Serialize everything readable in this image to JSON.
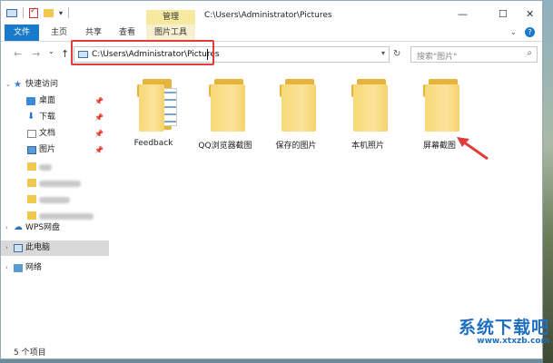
{
  "window": {
    "title": "C:\\Users\\Administrator\\Pictures",
    "context_tab_group": "管理",
    "controls": {
      "minimize": "—",
      "maximize": "☐",
      "close": "✕"
    }
  },
  "ribbon": {
    "tabs": [
      "文件",
      "主页",
      "共享",
      "查看",
      "图片工具"
    ],
    "expand_icon": "chevron-down-icon",
    "help_icon": "?"
  },
  "address": {
    "path": "C:\\Users\\Administrator\\Pictures",
    "search_placeholder": "搜索\"图片\""
  },
  "sidebar": {
    "items": [
      {
        "label": "快速访问",
        "icon": "star-icon",
        "pinned": false
      },
      {
        "label": "桌面",
        "icon": "desktop-icon",
        "pinned": true
      },
      {
        "label": "下载",
        "icon": "download-icon",
        "pinned": true
      },
      {
        "label": "文档",
        "icon": "document-icon",
        "pinned": true
      },
      {
        "label": "图片",
        "icon": "picture-icon",
        "pinned": true
      },
      {
        "label": "WPS网盘",
        "icon": "cloud-icon"
      },
      {
        "label": "此电脑",
        "icon": "computer-icon",
        "selected": true
      },
      {
        "label": "网络",
        "icon": "network-icon"
      }
    ]
  },
  "folders": [
    {
      "name": "Feedback"
    },
    {
      "name": "QQ浏览器截图"
    },
    {
      "name": "保存的图片"
    },
    {
      "name": "本机照片"
    },
    {
      "name": "屏幕截图"
    }
  ],
  "status": {
    "item_count": "5 个项目"
  },
  "watermark": {
    "brand": "系统下载吧",
    "url": "www.xtxzb.com"
  },
  "colors": {
    "accent": "#1979ca",
    "highlight": "#e23b3b",
    "folder": "#f7d978"
  }
}
